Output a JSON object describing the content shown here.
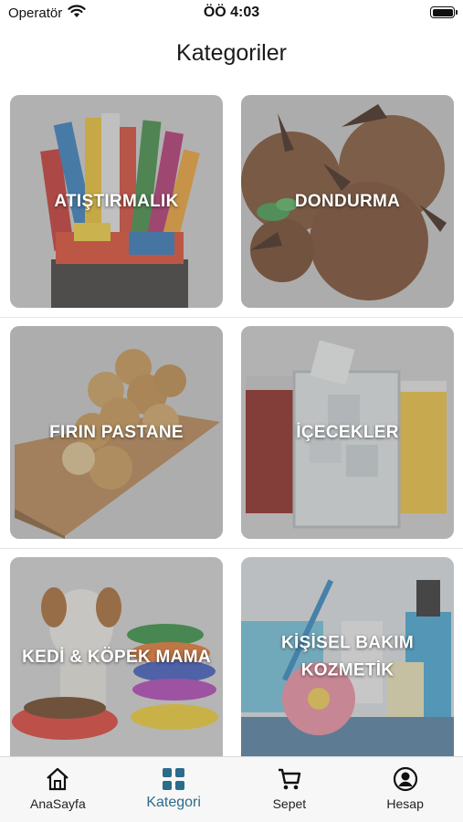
{
  "status_bar": {
    "carrier": "Operatör",
    "time": "ÖÖ 4:03",
    "icons": [
      "wifi-icon",
      "battery-icon"
    ]
  },
  "header": {
    "title": "Kategoriler"
  },
  "categories": [
    {
      "label": "ATIŞTIRMALIK",
      "image": "snacks-basket"
    },
    {
      "label": "DONDURMA",
      "image": "chocolate-ice-cream"
    },
    {
      "label": "FIRIN PASTANE",
      "image": "bread-rolls-board"
    },
    {
      "label": "İÇECEKLER",
      "image": "drink-glasses"
    },
    {
      "label": "KEDİ & KÖPEK MAMA",
      "image": "puppy-pet-bowls"
    },
    {
      "label": "KİŞİSEL BAKIM KOZMETİK",
      "image": "toiletries-flower"
    }
  ],
  "tab_bar": {
    "active_color": "#2c6b8a",
    "tabs": [
      {
        "label": "AnaSayfa",
        "icon": "home-icon"
      },
      {
        "label": "Kategori",
        "icon": "grid-icon",
        "active": true
      },
      {
        "label": "Sepet",
        "icon": "cart-icon"
      },
      {
        "label": "Hesap",
        "icon": "account-icon"
      }
    ]
  }
}
